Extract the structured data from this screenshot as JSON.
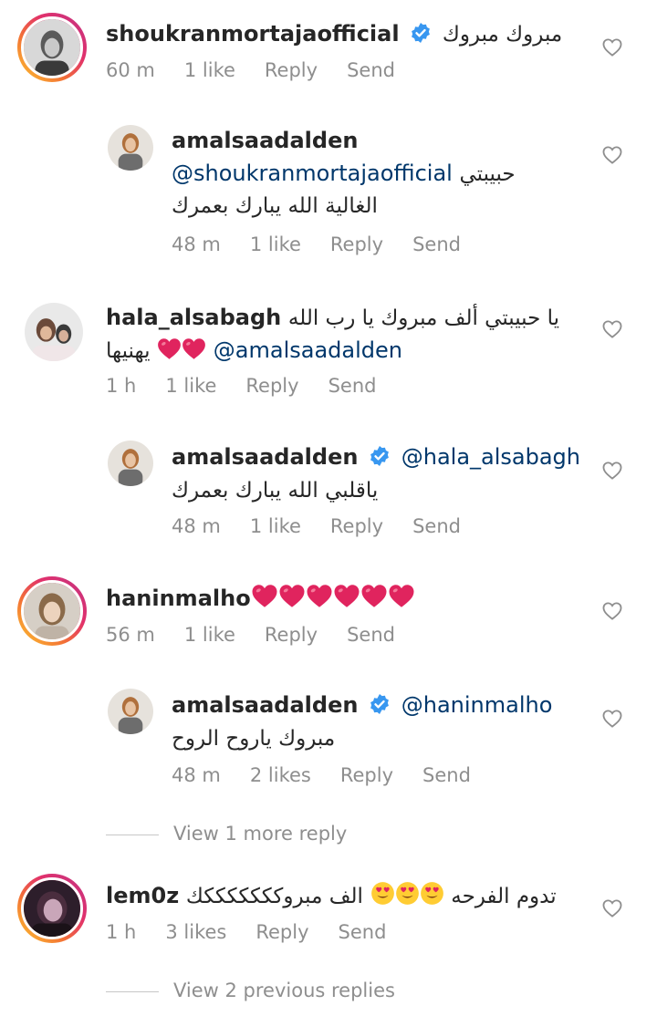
{
  "comments": [
    {
      "username": "shoukranmortajaofficial",
      "text": "مبروك مبروك",
      "time": "60 m",
      "likes": "1 like",
      "reply": "Reply",
      "send": "Send"
    },
    {
      "username": "amalsaadalden",
      "mention": "@shoukranmortajaofficial",
      "text_a": "حبيبتي",
      "text_b": "الغالية الله يبارك بعمرك",
      "time": "48 m",
      "likes": "1 like",
      "reply": "Reply",
      "send": "Send"
    },
    {
      "username": "hala_alsabagh",
      "text_a": "يا حبيبتي ألف مبروك يا رب الله",
      "mention": "@amalsaadalden",
      "text_b": "يهنيها",
      "time": "1 h",
      "likes": "1 like",
      "reply": "Reply",
      "send": "Send"
    },
    {
      "username": "amalsaadalden",
      "mention": "@hala_alsabagh",
      "text": "ياقلبي الله يبارك بعمرك",
      "time": "48 m",
      "likes": "1 like",
      "reply": "Reply",
      "send": "Send"
    },
    {
      "username": "haninmalho",
      "time": "56 m",
      "likes": "1 like",
      "reply": "Reply",
      "send": "Send"
    },
    {
      "username": "amalsaadalden",
      "mention": "@haninmalho",
      "text": "مبروك ياروح الروح",
      "time": "48 m",
      "likes": "2 likes",
      "reply": "Reply",
      "send": "Send"
    },
    {
      "username": "lem0z",
      "text_a": "تدوم الفرحه",
      "text_b": "الف مبروكككككككك",
      "time": "1 h",
      "likes": "3 likes",
      "reply": "Reply",
      "send": "Send"
    }
  ],
  "view_more_reply": "View 1 more reply",
  "view_previous_replies": "View 2 previous replies",
  "colors": {
    "verified": "#3897f0",
    "heart_emoji": "#e0245e",
    "mention": "#00376b",
    "meta": "#8e8e8e"
  },
  "icons": {
    "like": "heart-outline-icon",
    "verified": "verified-badge-icon",
    "emoji_heart": "red-heart-emoji",
    "emoji_love": "heart-eyes-emoji"
  }
}
